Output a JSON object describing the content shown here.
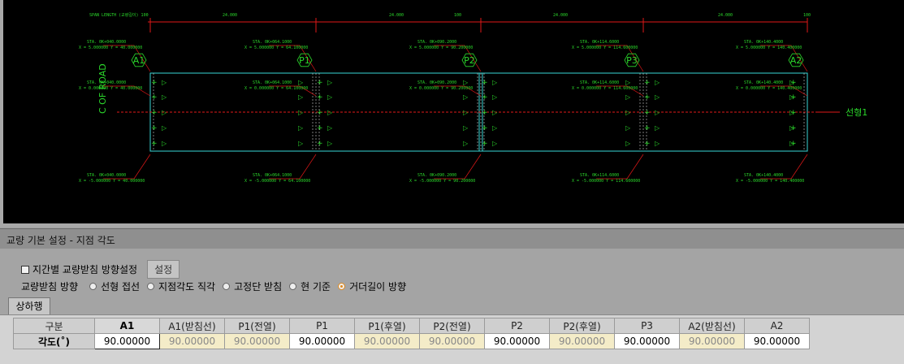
{
  "cad": {
    "span_label": "SPAN LENGTH (교량길이) 100",
    "span_dims": [
      "24.000",
      "24.000",
      "100",
      "24.000",
      "24.000",
      "100"
    ],
    "piers": [
      "A1",
      "P1",
      "P2",
      "P3",
      "A2"
    ],
    "alignment_label": "선형1",
    "cl_label": "C OF ROAD",
    "sta_top": [
      "STA. 0K+040.0000",
      "STA. 0K+064.1000",
      "STA. 0K+090.2000",
      "STA. 0K+114.6000",
      "STA. 0K+140.4000"
    ],
    "coord_top": [
      "X = 5.000000  Y = 40.000000",
      "X = 5.000000  Y = 64.100000",
      "X = 5.000000  Y = 90.200000",
      "X = 5.000000  Y = 114.600000",
      "X = 5.000000  Y = 140.400000"
    ],
    "coord_mid": [
      "X = 0.000000  Y = 40.000000",
      "X = 0.000000  Y = 64.100000",
      "X = 0.000000  Y = 90.200000",
      "X = 0.000000  Y = 114.600000",
      "X = 0.000000  Y = 140.400000"
    ],
    "coord_bot": [
      "X = -5.000000  Y = 40.000000",
      "X = -5.000000  Y = 64.100000",
      "X = -5.000000  Y = 90.200000",
      "X = -5.000000  Y = 114.600000",
      "X = -5.000000  Y = 140.400000"
    ]
  },
  "panel": {
    "title": "교량 기본 설정 - 지점 각도",
    "checkbox_label": "지간별 교량받침 방향설정",
    "set_button": "설정",
    "direction_label": "교량받침 방향",
    "radio_options": [
      "선형 접선",
      "지점각도 직각",
      "고정단 받침",
      "현 기준",
      "거더길이 방향"
    ],
    "radio_selected": "거더길이 방향",
    "tab_label": "상하행"
  },
  "grid": {
    "corner": "구분",
    "headers": [
      "A1",
      "A1(받침선)",
      "P1(전열)",
      "P1",
      "P1(후열)",
      "P2(전열)",
      "P2",
      "P2(후열)",
      "P3",
      "A2(받침선)",
      "A2"
    ],
    "row_label": "각도(˚)",
    "values": [
      "90.00000",
      "90.00000",
      "90.00000",
      "90.00000",
      "90.00000",
      "90.00000",
      "90.00000",
      "90.00000",
      "90.00000",
      "90.00000",
      "90.00000"
    ]
  }
}
